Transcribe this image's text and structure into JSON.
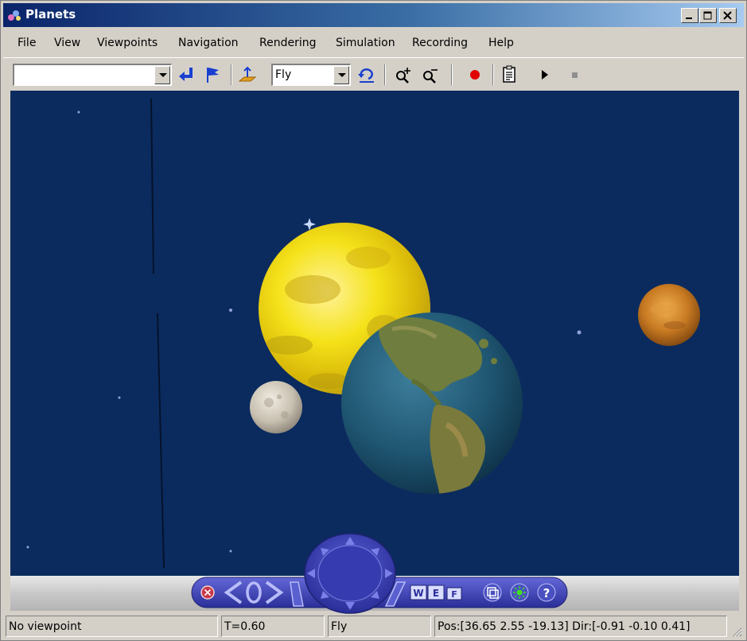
{
  "window": {
    "title": "Planets"
  },
  "menu": [
    "File",
    "View",
    "Viewpoints",
    "Navigation",
    "Rendering",
    "Simulation",
    "Recording",
    "Help"
  ],
  "toolbar": {
    "viewpoint_combo_value": "",
    "navmode_combo_value": "Fly",
    "icons": [
      "return-arrow-icon",
      "flag-icon",
      "ground-plane-icon",
      "undo-move-icon",
      "zoom-in-icon",
      "zoom-out-icon",
      "record-icon",
      "playlist-icon",
      "play-icon",
      "stop-icon"
    ]
  },
  "navpanel": {
    "buttons": [
      "W",
      "E",
      "F"
    ],
    "help_label": "?"
  },
  "status": {
    "viewpoint": "No viewpoint",
    "time": "T=0.60",
    "mode": "Fly",
    "position": "Pos:[36.65 2.55 -19.13] Dir:[-0.91 -0.10 0.41]"
  },
  "colors": {
    "titlebar_start": "#0a246a",
    "titlebar_end": "#a6caf0",
    "space": "#0b2b5e",
    "sun": "#f2dc12",
    "navpanel": "#3438a8",
    "record": "#e00000"
  }
}
